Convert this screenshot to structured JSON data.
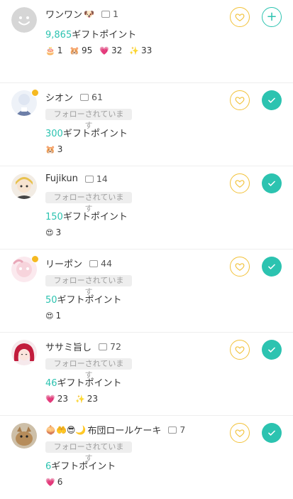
{
  "colors": {
    "accent": "#2cc3b0",
    "heart": "#f2c23a",
    "tag_bg": "#eeeeee"
  },
  "users": [
    {
      "name": "ワンワン",
      "name_emoji": "🐶",
      "comments": "1",
      "follow_tag": "",
      "points_value": "9,865",
      "points_suffix": "ギフトポイント",
      "gifts": [
        {
          "icon": "cake-gift-icon",
          "glyph": "🎂",
          "count": "1"
        },
        {
          "icon": "hamster-gift-icon",
          "glyph": "🐹",
          "count": "95"
        },
        {
          "icon": "heart-gift-icon",
          "glyph": "💗",
          "count": "32"
        },
        {
          "icon": "sparkle-gift-icon",
          "glyph": "✨",
          "count": "33"
        }
      ],
      "follow_state": "follow",
      "follow_glyph": "+"
    },
    {
      "name": "シオン",
      "name_emoji": "",
      "comments": "61",
      "follow_tag": "フォローされています",
      "points_value": "300",
      "points_suffix": "ギフトポイント",
      "gifts": [
        {
          "icon": "hamster-gift-icon",
          "glyph": "🐹",
          "count": "3"
        }
      ],
      "follow_state": "following"
    },
    {
      "name": "Fujikun",
      "name_emoji": "",
      "comments": "14",
      "follow_tag": "フォローされています",
      "points_value": "150",
      "points_suffix": "ギフトポイント",
      "gifts": [
        {
          "icon": "love-face-gift-icon",
          "glyph": "😍",
          "count": "3"
        }
      ],
      "follow_state": "following"
    },
    {
      "name": "リーポン",
      "name_emoji": "",
      "comments": "44",
      "follow_tag": "フォローされています",
      "points_value": "50",
      "points_suffix": "ギフトポイント",
      "gifts": [
        {
          "icon": "love-face-gift-icon",
          "glyph": "😍",
          "count": "1"
        }
      ],
      "follow_state": "following"
    },
    {
      "name": "ササミ旨し",
      "name_emoji": "",
      "comments": "72",
      "follow_tag": "フォローされています",
      "points_value": "46",
      "points_suffix": "ギフトポイント",
      "gifts": [
        {
          "icon": "heart-gift-icon",
          "glyph": "💗",
          "count": "23"
        },
        {
          "icon": "sparkle-gift-icon",
          "glyph": "✨",
          "count": "23"
        }
      ],
      "follow_state": "following"
    },
    {
      "name": "布団ロールケーキ",
      "name_emoji": "🧅🤲😎🌙",
      "comments": "7",
      "follow_tag": "フォローされています",
      "points_value": "6",
      "points_suffix": "ギフトポイント",
      "gifts": [
        {
          "icon": "heart-gift-icon",
          "glyph": "💗",
          "count": "6"
        }
      ],
      "follow_state": "following"
    }
  ]
}
